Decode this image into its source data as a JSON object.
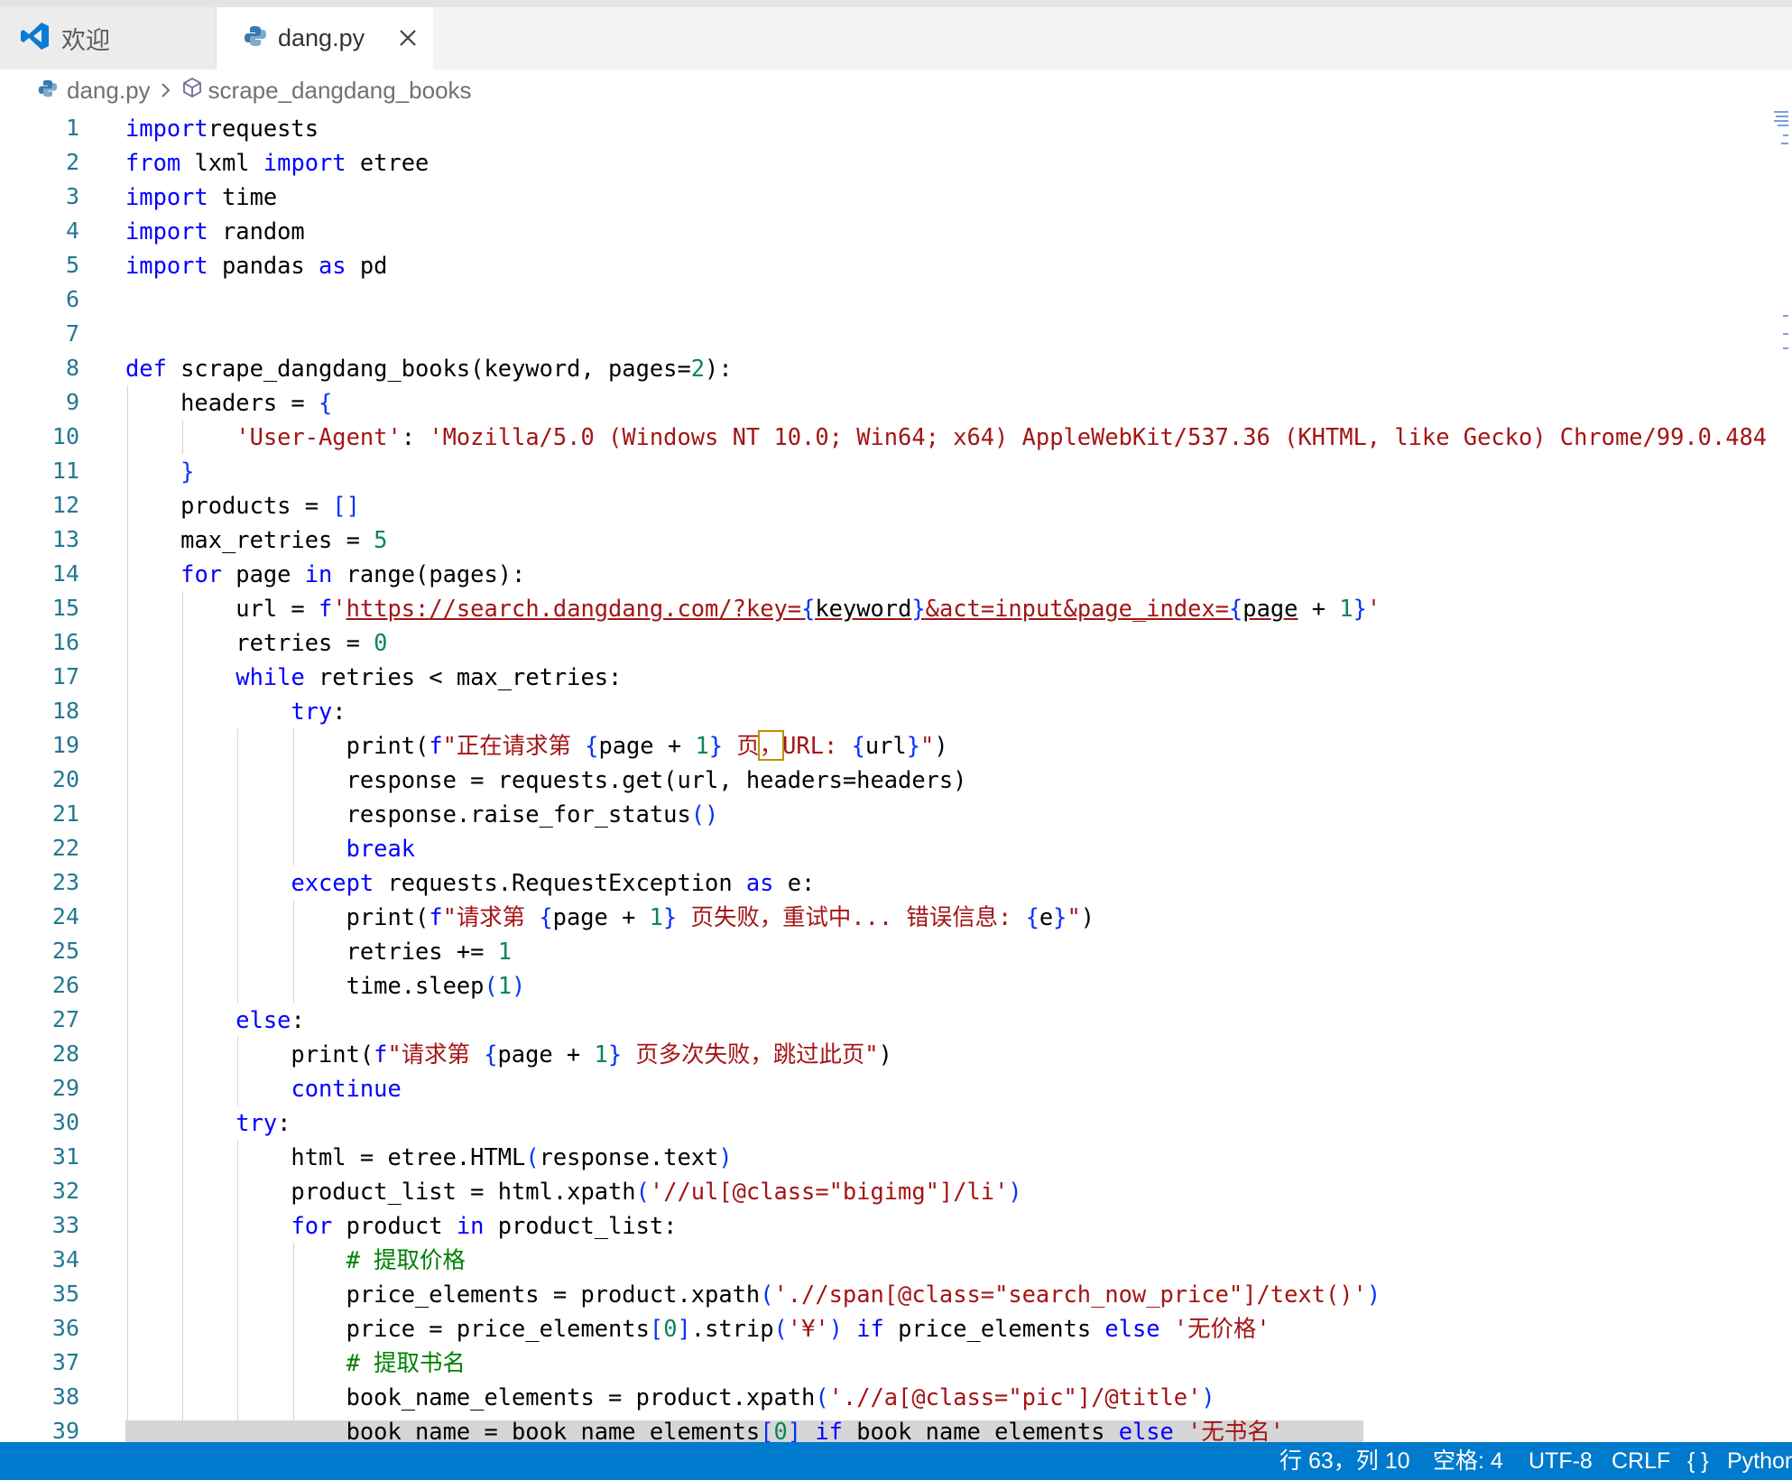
{
  "tabs": [
    {
      "label": "欢迎",
      "icon": "vscode-logo-icon"
    },
    {
      "label": "dang.py",
      "icon": "python-icon",
      "active": true
    }
  ],
  "breadcrumb": {
    "file": "dang.py",
    "symbol": "scrape_dangdang_books"
  },
  "code_lines": [
    {
      "n": "1",
      "tokens": [
        [
          "kw",
          "import"
        ],
        [
          "",
          "requests"
        ]
      ]
    },
    {
      "n": "2",
      "tokens": [
        [
          "kw",
          "from"
        ],
        [
          "",
          " lxml "
        ],
        [
          "kw",
          "import"
        ],
        [
          "",
          " etree"
        ]
      ]
    },
    {
      "n": "3",
      "tokens": [
        [
          "kw",
          "import"
        ],
        [
          "",
          " time"
        ]
      ]
    },
    {
      "n": "4",
      "tokens": [
        [
          "kw",
          "import"
        ],
        [
          "",
          " random"
        ]
      ]
    },
    {
      "n": "5",
      "tokens": [
        [
          "kw",
          "import"
        ],
        [
          "",
          " pandas "
        ],
        [
          "kw",
          "as"
        ],
        [
          "",
          " pd"
        ]
      ]
    },
    {
      "n": "6",
      "tokens": []
    },
    {
      "n": "7",
      "tokens": []
    },
    {
      "n": "8",
      "tokens": [
        [
          "kw",
          "def"
        ],
        [
          "",
          " scrape_dangdang_books(keyword, pages="
        ],
        [
          "num",
          "2"
        ],
        [
          "",
          "):"
        ]
      ]
    },
    {
      "n": "9",
      "tokens": [
        [
          "",
          "    headers = "
        ],
        [
          "br",
          "{"
        ]
      ]
    },
    {
      "n": "10",
      "tokens": [
        [
          "",
          "        "
        ],
        [
          "str",
          "'User-Agent'"
        ],
        [
          "",
          ": "
        ],
        [
          "str",
          "'Mozilla/5.0 (Windows NT 10.0; Win64; x64) AppleWebKit/537.36 (KHTML, like Gecko) Chrome/99.0.484"
        ]
      ]
    },
    {
      "n": "11",
      "tokens": [
        [
          "",
          "    "
        ],
        [
          "br",
          "}"
        ]
      ]
    },
    {
      "n": "12",
      "tokens": [
        [
          "",
          "    products = "
        ],
        [
          "br",
          "[]"
        ]
      ]
    },
    {
      "n": "13",
      "tokens": [
        [
          "",
          "    max_retries = "
        ],
        [
          "num",
          "5"
        ]
      ]
    },
    {
      "n": "14",
      "tokens": [
        [
          "",
          "    "
        ],
        [
          "kw",
          "for"
        ],
        [
          "",
          " page "
        ],
        [
          "kw",
          "in"
        ],
        [
          "",
          " range(pages):"
        ]
      ]
    },
    {
      "n": "15",
      "tokens": [
        [
          "",
          "        url = "
        ],
        [
          "kw",
          "f"
        ],
        [
          "str",
          "'"
        ],
        [
          "str ul",
          "https://search.dangdang.com/?key="
        ],
        [
          "br ul",
          "{"
        ],
        [
          "ul",
          "keyword"
        ],
        [
          "br ul",
          "}"
        ],
        [
          "str ul",
          "&act=input&page_index="
        ],
        [
          "br ul",
          "{"
        ],
        [
          "ul",
          "page"
        ],
        [
          "",
          " + "
        ],
        [
          "num",
          "1"
        ],
        [
          "br",
          "}"
        ],
        [
          "str",
          "'"
        ]
      ]
    },
    {
      "n": "16",
      "tokens": [
        [
          "",
          "        retries = "
        ],
        [
          "num",
          "0"
        ]
      ]
    },
    {
      "n": "17",
      "tokens": [
        [
          "",
          "        "
        ],
        [
          "kw",
          "while"
        ],
        [
          "",
          " retries < max_retries:"
        ]
      ]
    },
    {
      "n": "18",
      "tokens": [
        [
          "",
          "            "
        ],
        [
          "kw",
          "try"
        ],
        [
          "",
          ":"
        ]
      ]
    },
    {
      "n": "19",
      "tokens": [
        [
          "",
          "                print("
        ],
        [
          "kw",
          "f"
        ],
        [
          "str",
          "\"正在请求第 "
        ],
        [
          "br",
          "{"
        ],
        [
          "",
          "page + "
        ],
        [
          "num",
          "1"
        ],
        [
          "br",
          "}"
        ],
        [
          "str",
          " 页"
        ],
        [
          "str cur",
          "，"
        ],
        [
          "str",
          "URL: "
        ],
        [
          "br",
          "{"
        ],
        [
          "",
          "url"
        ],
        [
          "br",
          "}"
        ],
        [
          "str",
          "\""
        ],
        [
          "",
          ")"
        ]
      ]
    },
    {
      "n": "20",
      "tokens": [
        [
          "",
          "                response = requests.get(url, headers=headers)"
        ]
      ]
    },
    {
      "n": "21",
      "tokens": [
        [
          "",
          "                response.raise_for_status"
        ],
        [
          "br",
          "()"
        ]
      ]
    },
    {
      "n": "22",
      "tokens": [
        [
          "",
          "                "
        ],
        [
          "kw",
          "break"
        ]
      ]
    },
    {
      "n": "23",
      "tokens": [
        [
          "",
          "            "
        ],
        [
          "kw",
          "except"
        ],
        [
          "",
          " requests.RequestException "
        ],
        [
          "kw",
          "as"
        ],
        [
          "",
          " e:"
        ]
      ]
    },
    {
      "n": "24",
      "tokens": [
        [
          "",
          "                print("
        ],
        [
          "kw",
          "f"
        ],
        [
          "str",
          "\"请求第 "
        ],
        [
          "br",
          "{"
        ],
        [
          "",
          "page + "
        ],
        [
          "num",
          "1"
        ],
        [
          "br",
          "}"
        ],
        [
          "str",
          " 页失败，重试中... 错误信息: "
        ],
        [
          "br",
          "{"
        ],
        [
          "",
          "e"
        ],
        [
          "br",
          "}"
        ],
        [
          "str",
          "\""
        ],
        [
          "",
          ")"
        ]
      ]
    },
    {
      "n": "25",
      "tokens": [
        [
          "",
          "                retries += "
        ],
        [
          "num",
          "1"
        ]
      ]
    },
    {
      "n": "26",
      "tokens": [
        [
          "",
          "                time.sleep"
        ],
        [
          "br",
          "("
        ],
        [
          "num",
          "1"
        ],
        [
          "br",
          ")"
        ]
      ]
    },
    {
      "n": "27",
      "tokens": [
        [
          "",
          "        "
        ],
        [
          "kw",
          "else"
        ],
        [
          "",
          ":"
        ]
      ]
    },
    {
      "n": "28",
      "tokens": [
        [
          "",
          "            print("
        ],
        [
          "kw",
          "f"
        ],
        [
          "str",
          "\"请求第 "
        ],
        [
          "br",
          "{"
        ],
        [
          "",
          "page + "
        ],
        [
          "num",
          "1"
        ],
        [
          "br",
          "}"
        ],
        [
          "str",
          " 页多次失败，跳过此页\""
        ],
        [
          "",
          ")"
        ]
      ]
    },
    {
      "n": "29",
      "tokens": [
        [
          "",
          "            "
        ],
        [
          "kw",
          "continue"
        ]
      ]
    },
    {
      "n": "30",
      "tokens": [
        [
          "",
          "        "
        ],
        [
          "kw",
          "try"
        ],
        [
          "",
          ":"
        ]
      ]
    },
    {
      "n": "31",
      "tokens": [
        [
          "",
          "            html = etree.HTML"
        ],
        [
          "br",
          "("
        ],
        [
          "",
          "response.text"
        ],
        [
          "br",
          ")"
        ]
      ]
    },
    {
      "n": "32",
      "tokens": [
        [
          "",
          "            product_list = html.xpath"
        ],
        [
          "br",
          "("
        ],
        [
          "str",
          "'//ul[@class=\"bigimg\"]/li'"
        ],
        [
          "br",
          ")"
        ]
      ]
    },
    {
      "n": "33",
      "tokens": [
        [
          "",
          "            "
        ],
        [
          "kw",
          "for"
        ],
        [
          "",
          " product "
        ],
        [
          "kw",
          "in"
        ],
        [
          "",
          " product_list:"
        ]
      ]
    },
    {
      "n": "34",
      "tokens": [
        [
          "",
          "                "
        ],
        [
          "cm",
          "# 提取价格"
        ]
      ]
    },
    {
      "n": "35",
      "tokens": [
        [
          "",
          "                price_elements = product.xpath"
        ],
        [
          "br",
          "("
        ],
        [
          "str",
          "'.//span[@class=\"search_now_price\"]/text()'"
        ],
        [
          "br",
          ")"
        ]
      ]
    },
    {
      "n": "36",
      "tokens": [
        [
          "",
          "                price = price_elements"
        ],
        [
          "br",
          "["
        ],
        [
          "num",
          "0"
        ],
        [
          "br",
          "]"
        ],
        [
          "",
          ".strip"
        ],
        [
          "br",
          "("
        ],
        [
          "str",
          "'¥'"
        ],
        [
          "br",
          ")"
        ],
        [
          "",
          " "
        ],
        [
          "kw",
          "if"
        ],
        [
          "",
          " price_elements "
        ],
        [
          "kw",
          "else"
        ],
        [
          "",
          " "
        ],
        [
          "str",
          "'无价格'"
        ]
      ]
    },
    {
      "n": "37",
      "tokens": [
        [
          "",
          "                "
        ],
        [
          "cm",
          "# 提取书名"
        ]
      ]
    },
    {
      "n": "38",
      "tokens": [
        [
          "",
          "                book_name_elements = product.xpath"
        ],
        [
          "br",
          "("
        ],
        [
          "str",
          "'.//a[@class=\"pic\"]/@title'"
        ],
        [
          "br",
          ")"
        ]
      ]
    },
    {
      "n": "39",
      "tokens": [
        [
          "",
          "                book_name = book_name_elements"
        ],
        [
          "br",
          "["
        ],
        [
          "num",
          "0"
        ],
        [
          "br",
          "]"
        ],
        [
          "",
          " "
        ],
        [
          "kw",
          "if"
        ],
        [
          "",
          " book_name_elements "
        ],
        [
          "kw",
          "else"
        ],
        [
          "",
          " "
        ],
        [
          "str",
          "'无书名'"
        ]
      ]
    }
  ],
  "status": {
    "position": "行 63，列 10",
    "indent": "空格: 4",
    "encoding": "UTF-8",
    "eol": "CRLF",
    "language": "Python",
    "language_icon": "braces-icon"
  },
  "colors": {
    "keyword": "#0000ff",
    "string": "#a31515",
    "number": "#098658",
    "comment": "#008000",
    "line_number": "#237893",
    "status_bar": "#007acc"
  }
}
